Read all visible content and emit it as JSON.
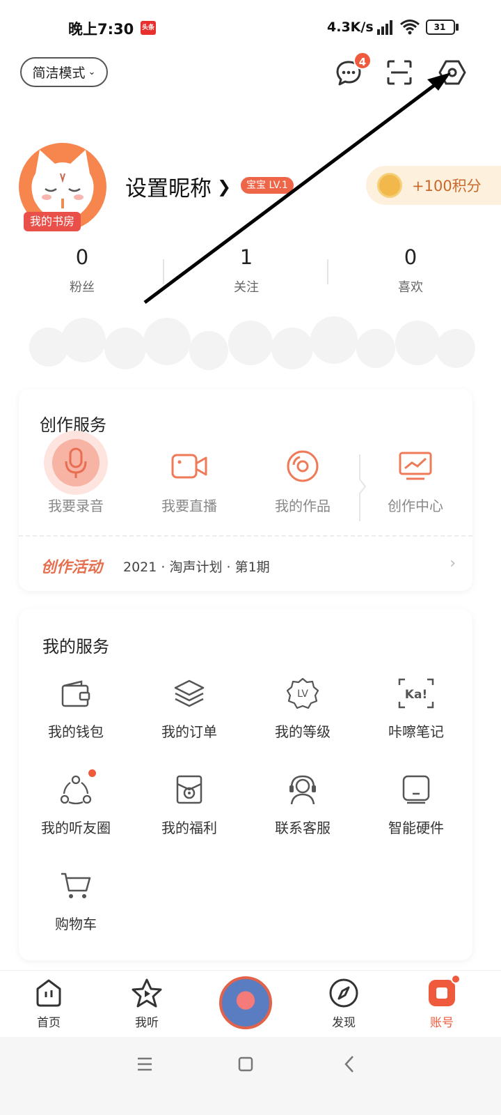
{
  "status_bar": {
    "time": "晚上7:30",
    "news_label": "头条",
    "net_speed": "4.3K/s",
    "battery": "31"
  },
  "header": {
    "mode_label": "简洁模式",
    "message_badge": "4"
  },
  "profile": {
    "avatar_tag": "我的书房",
    "nickname": "设置昵称",
    "level_badge": "宝宝 LV.1",
    "points_label": "+100积分",
    "stats": [
      {
        "value": "0",
        "label": "粉丝"
      },
      {
        "value": "1",
        "label": "关注"
      },
      {
        "value": "0",
        "label": "喜欢"
      }
    ]
  },
  "create_card": {
    "title": "创作服务",
    "items": [
      {
        "label": "我要录音",
        "icon": "microphone-icon"
      },
      {
        "label": "我要直播",
        "icon": "video-camera-icon"
      },
      {
        "label": "我的作品",
        "icon": "disc-icon"
      },
      {
        "label": "创作中心",
        "icon": "monitor-chart-icon"
      }
    ],
    "activity_title": "创作活动",
    "activity_text": "2021 · 淘声计划 · 第1期"
  },
  "service_card": {
    "title": "我的服务",
    "items": [
      {
        "label": "我的钱包",
        "icon": "wallet-icon"
      },
      {
        "label": "我的订单",
        "icon": "layers-icon"
      },
      {
        "label": "我的等级",
        "icon": "level-badge-icon"
      },
      {
        "label": "咔嚓笔记",
        "icon": "ka-note-icon"
      },
      {
        "label": "我的听友圈",
        "icon": "friends-circle-icon"
      },
      {
        "label": "我的福利",
        "icon": "gift-box-icon"
      },
      {
        "label": "联系客服",
        "icon": "headset-icon"
      },
      {
        "label": "智能硬件",
        "icon": "speaker-device-icon"
      },
      {
        "label": "购物车",
        "icon": "shopping-cart-icon"
      }
    ]
  },
  "bottom_nav": {
    "items": [
      {
        "label": "首页"
      },
      {
        "label": "我听"
      },
      {
        "label": "发现"
      },
      {
        "label": "账号"
      }
    ]
  },
  "colors": {
    "accent": "#ef5a3c",
    "activity": "#e66f4f",
    "points_bg": "#fdf0dc"
  }
}
